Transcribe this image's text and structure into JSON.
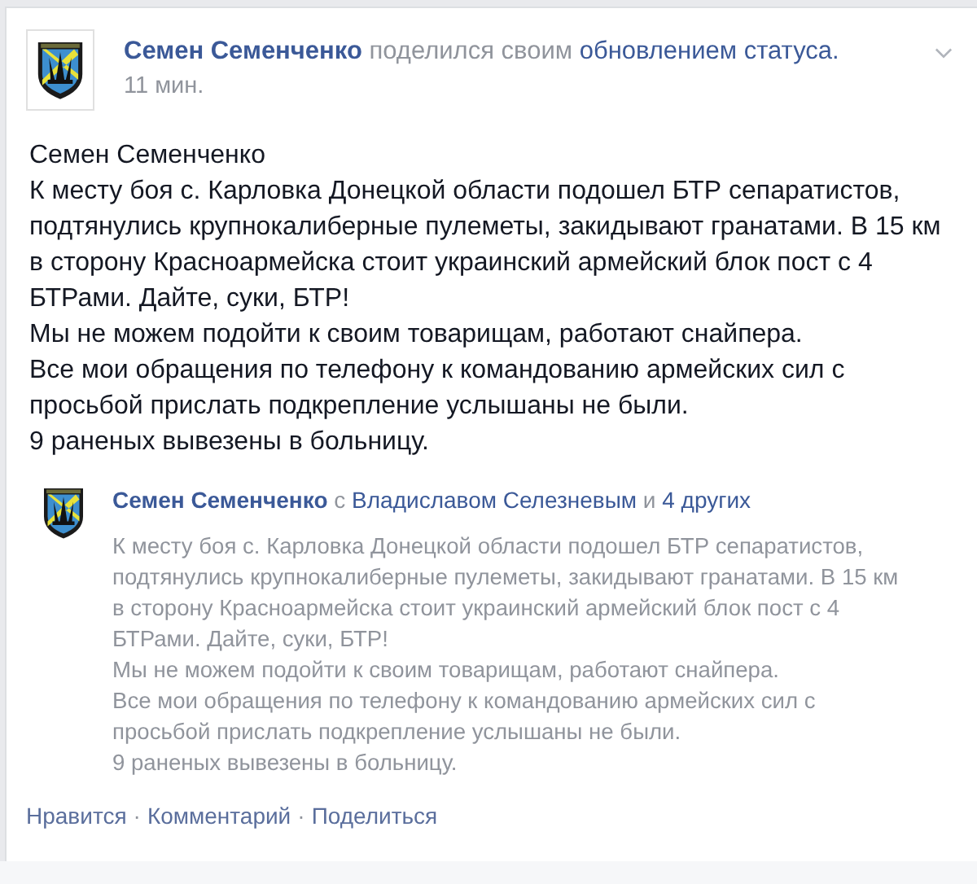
{
  "post": {
    "author": "Семен Семенченко",
    "action": "поделился своим",
    "action_link": "обновлением статуса.",
    "time": "11 мин.",
    "title": "Семен Семенченко",
    "paragraphs": [
      "К месту боя с. Карловка Донецкой области подошел БТР сепаратистов, подтянулись крупнокалиберные пулеметы, закидывают гранатами. В 15 км в сторону Красноармейска стоит украинский армейский блок пост с 4 БТРами. Дайте, суки, БТР!",
      "Мы не можем подойти к своим товарищам, работают снайпера.",
      "Все мои обращения по телефону к командованию армейских сил с просьбой прислать подкрепление услышаны не были.",
      "9 раненых вывезены в больницу."
    ],
    "shared": {
      "author": "Семен Семенченко",
      "with": "с",
      "tagged": "Владиславом Селезневым",
      "and": "и",
      "others": "4 других",
      "paragraphs": [
        "К месту боя с. Карловка Донецкой области подошел БТР сепаратистов, подтянулись крупнокалиберные пулеметы, закидывают гранатами. В 15 км в сторону Красноармейска стоит украинский армейский блок пост с 4 БТРами. Дайте, суки, БТР!",
        "Мы не можем подойти к своим товарищам, работают снайпера.",
        "Все мои обращения по телефону к командованию армейских сил с просьбой прислать подкрепление услышаны не были.",
        "9 раненых вывезены в больницу."
      ]
    },
    "actions": [
      "Нравится",
      "Комментарий",
      "Поделиться"
    ],
    "separator": "·"
  }
}
